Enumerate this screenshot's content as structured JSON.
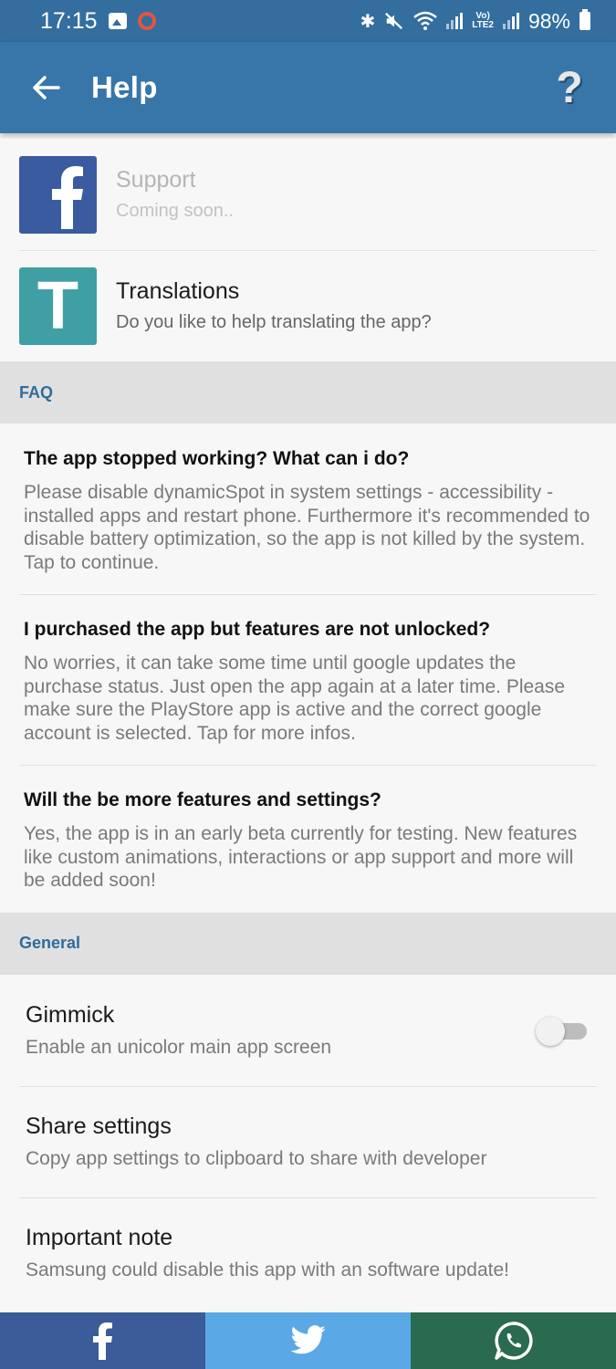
{
  "status_bar": {
    "time": "17:15",
    "battery": "98%",
    "network_label": "LTE2"
  },
  "app_bar": {
    "title": "Help"
  },
  "links": [
    {
      "title": "Support",
      "subtitle": "Coming soon..",
      "enabled": false
    },
    {
      "title": "Translations",
      "subtitle": "Do you like to help translating the app?",
      "tile_letter": "T",
      "enabled": true
    }
  ],
  "faq": {
    "header": "FAQ",
    "items": [
      {
        "question": "The app stopped working? What can i do?",
        "answer": "Please disable dynamicSpot in system settings - accessibility - installed apps and restart phone. Furthermore it's recommended to disable battery optimization, so the app is not killed by the system. Tap to continue."
      },
      {
        "question": "I purchased the app but features are not unlocked?",
        "answer": "No worries, it can take some time until google updates the purchase status. Just open the app again at a later time. Please make sure the PlayStore app is active and the correct google account is selected. Tap for more infos."
      },
      {
        "question": "Will the be more features and settings?",
        "answer": "Yes, the app is in an early beta currently for testing. New features like custom animations, interactions or app support and more will be added soon!"
      }
    ]
  },
  "general": {
    "header": "General",
    "items": [
      {
        "title": "Gimmick",
        "subtitle": "Enable an unicolor main app screen",
        "toggle": false
      },
      {
        "title": "Share settings",
        "subtitle": "Copy app settings to clipboard to share with developer"
      },
      {
        "title": "Important note",
        "subtitle": "Samsung could disable this app with an software update!"
      }
    ]
  },
  "share_bar": [
    {
      "icon": "facebook-icon",
      "color": "#3b5b99"
    },
    {
      "icon": "twitter-icon",
      "color": "#5aa9e6"
    },
    {
      "icon": "whatsapp-icon",
      "color": "#2a6a4e"
    }
  ],
  "colors": {
    "primary": "#3876a9",
    "status_bar": "#336e9e",
    "section_header_text": "#2f6c9c"
  }
}
